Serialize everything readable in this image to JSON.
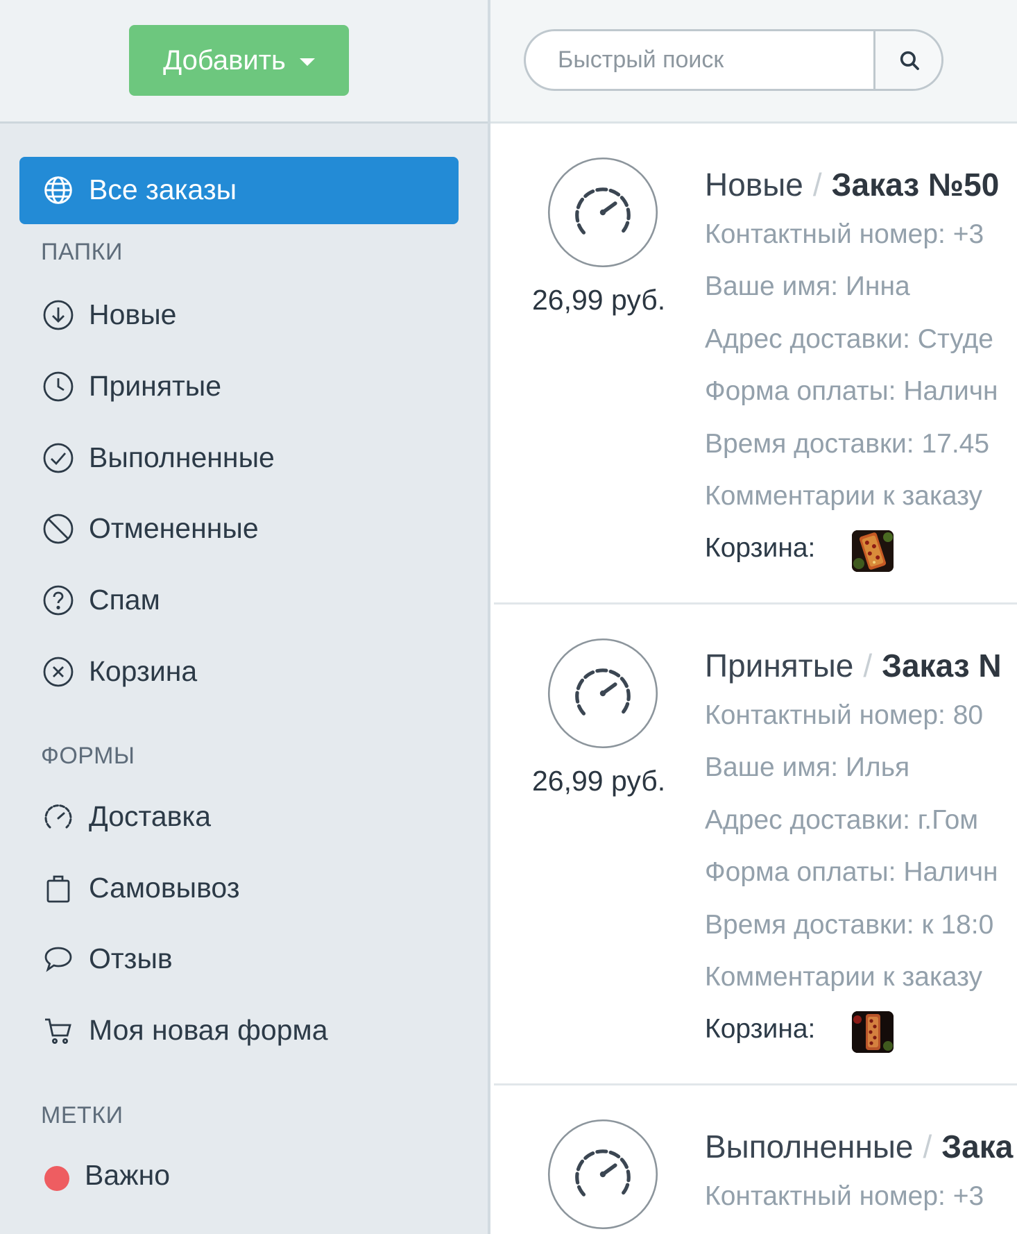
{
  "sidebar": {
    "add_button": "Добавить",
    "all_orders": "Все заказы",
    "folders_label": "ПАПКИ",
    "folders": [
      {
        "label": "Новые",
        "icon": "arrow-down-circle-icon"
      },
      {
        "label": "Принятые",
        "icon": "clock-icon"
      },
      {
        "label": "Выполненные",
        "icon": "check-circle-icon"
      },
      {
        "label": "Отмененные",
        "icon": "ban-icon"
      },
      {
        "label": "Спам",
        "icon": "question-circle-icon"
      },
      {
        "label": "Корзина",
        "icon": "x-circle-icon"
      }
    ],
    "forms_label": "ФОРМЫ",
    "forms": [
      {
        "label": "Доставка",
        "icon": "gauge-icon"
      },
      {
        "label": "Самовывоз",
        "icon": "bag-icon"
      },
      {
        "label": "Отзыв",
        "icon": "chat-bubble-icon"
      },
      {
        "label": "Моя новая форма",
        "icon": "cart-icon"
      }
    ],
    "tags_label": "МЕТКИ",
    "tags": [
      {
        "label": "Важно",
        "color": "#ee5d61"
      }
    ]
  },
  "search": {
    "placeholder": "Быстрый поиск"
  },
  "orders": [
    {
      "price": "26,99 руб.",
      "folder": "Новые",
      "separator": "/",
      "title": "Заказ №50",
      "fields": [
        "Контактный номер: +3",
        "Ваше имя: Инна",
        "Адрес доставки: Студе",
        "Форма оплаты: Наличн",
        "Время доставки: 17.45",
        "Комментарии к заказу"
      ],
      "cart_label": "Корзина:"
    },
    {
      "price": "26,99 руб.",
      "folder": "Принятые",
      "separator": "/",
      "title": "Заказ N",
      "fields": [
        "Контактный номер: 80",
        "Ваше имя: Илья",
        "Адрес доставки: г.Гом",
        "Форма оплаты: Наличн",
        "Время доставки: к 18:0",
        "Комментарии к заказу"
      ],
      "cart_label": "Корзина:"
    },
    {
      "folder": "Выполненные",
      "separator": "/",
      "title": "Зака",
      "fields": [
        "Контактный номер: +3"
      ]
    }
  ]
}
